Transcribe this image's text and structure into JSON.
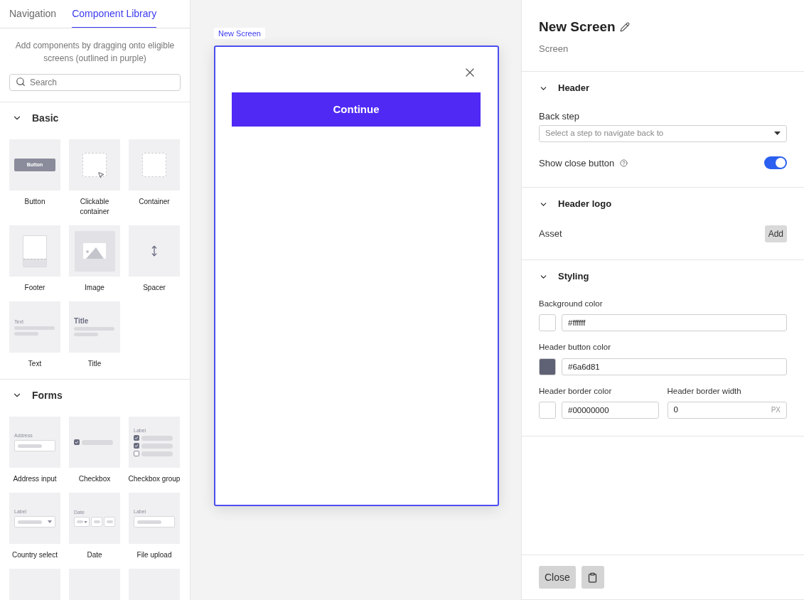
{
  "library": {
    "tabs": [
      {
        "label": "Navigation",
        "selected": false
      },
      {
        "label": "Component Library",
        "selected": true
      }
    ],
    "hint": "Add components by dragging onto eligible screens (outlined in purple)",
    "search": {
      "placeholder": "Search"
    },
    "sections": [
      {
        "title": "Basic",
        "expanded": true,
        "items": [
          {
            "label": "Button",
            "kind": "button",
            "preview_text": "Button"
          },
          {
            "label": "Clickable container",
            "kind": "clickable"
          },
          {
            "label": "Container",
            "kind": "container"
          },
          {
            "label": "Footer",
            "kind": "footer"
          },
          {
            "label": "Image",
            "kind": "image"
          },
          {
            "label": "Spacer",
            "kind": "spacer"
          },
          {
            "label": "Text",
            "kind": "text",
            "preview_text": "Text"
          },
          {
            "label": "Title",
            "kind": "title",
            "preview_text": "Title"
          }
        ]
      },
      {
        "title": "Forms",
        "expanded": true,
        "items": [
          {
            "label": "Address input",
            "kind": "address",
            "preview_text": "Address"
          },
          {
            "label": "Checkbox",
            "kind": "checkbox"
          },
          {
            "label": "Checkbox group",
            "kind": "checkbox_group",
            "preview_text": "Label"
          },
          {
            "label": "Country select",
            "kind": "country",
            "preview_text": "Label"
          },
          {
            "label": "Date",
            "kind": "date",
            "preview_text": "Date"
          },
          {
            "label": "File upload",
            "kind": "file",
            "preview_text": "Label"
          },
          {
            "kind": "blank"
          },
          {
            "kind": "blank"
          },
          {
            "kind": "blank"
          }
        ]
      }
    ]
  },
  "canvas": {
    "screen_label": "New Screen",
    "button": "Continue"
  },
  "inspector": {
    "title": "New Screen",
    "subtitle": "Screen",
    "sections": [
      {
        "title": "Header",
        "expanded": true,
        "rows": [
          {
            "fields": [
              {
                "kind": "select",
                "label": "Back step",
                "placeholder": "Select a step to navigate back to"
              }
            ]
          },
          {
            "fields": [
              {
                "kind": "toggle",
                "label": "Show close button",
                "on": true
              }
            ]
          }
        ]
      },
      {
        "title": "Header logo",
        "expanded": true,
        "rows": [
          {
            "fields": [
              {
                "kind": "asset",
                "label": "Asset",
                "button": "Add"
              }
            ]
          }
        ]
      },
      {
        "title": "Styling",
        "expanded": true,
        "rows": [
          {
            "fields": [
              {
                "kind": "color",
                "label": "Background color",
                "value": "#ffffff",
                "color": "#ffffff"
              }
            ]
          },
          {
            "fields": [
              {
                "kind": "color",
                "label": "Header button color",
                "value": "#6a6d81",
                "color": "#5f6275"
              }
            ]
          },
          {
            "fields": [
              {
                "kind": "color",
                "label": "Header border color",
                "value": "#00000000",
                "color": "#ffffff"
              },
              {
                "kind": "number",
                "label": "Header border width",
                "value": "0",
                "unit": "PX"
              }
            ]
          }
        ]
      }
    ],
    "footer": {
      "close": "Close"
    }
  }
}
